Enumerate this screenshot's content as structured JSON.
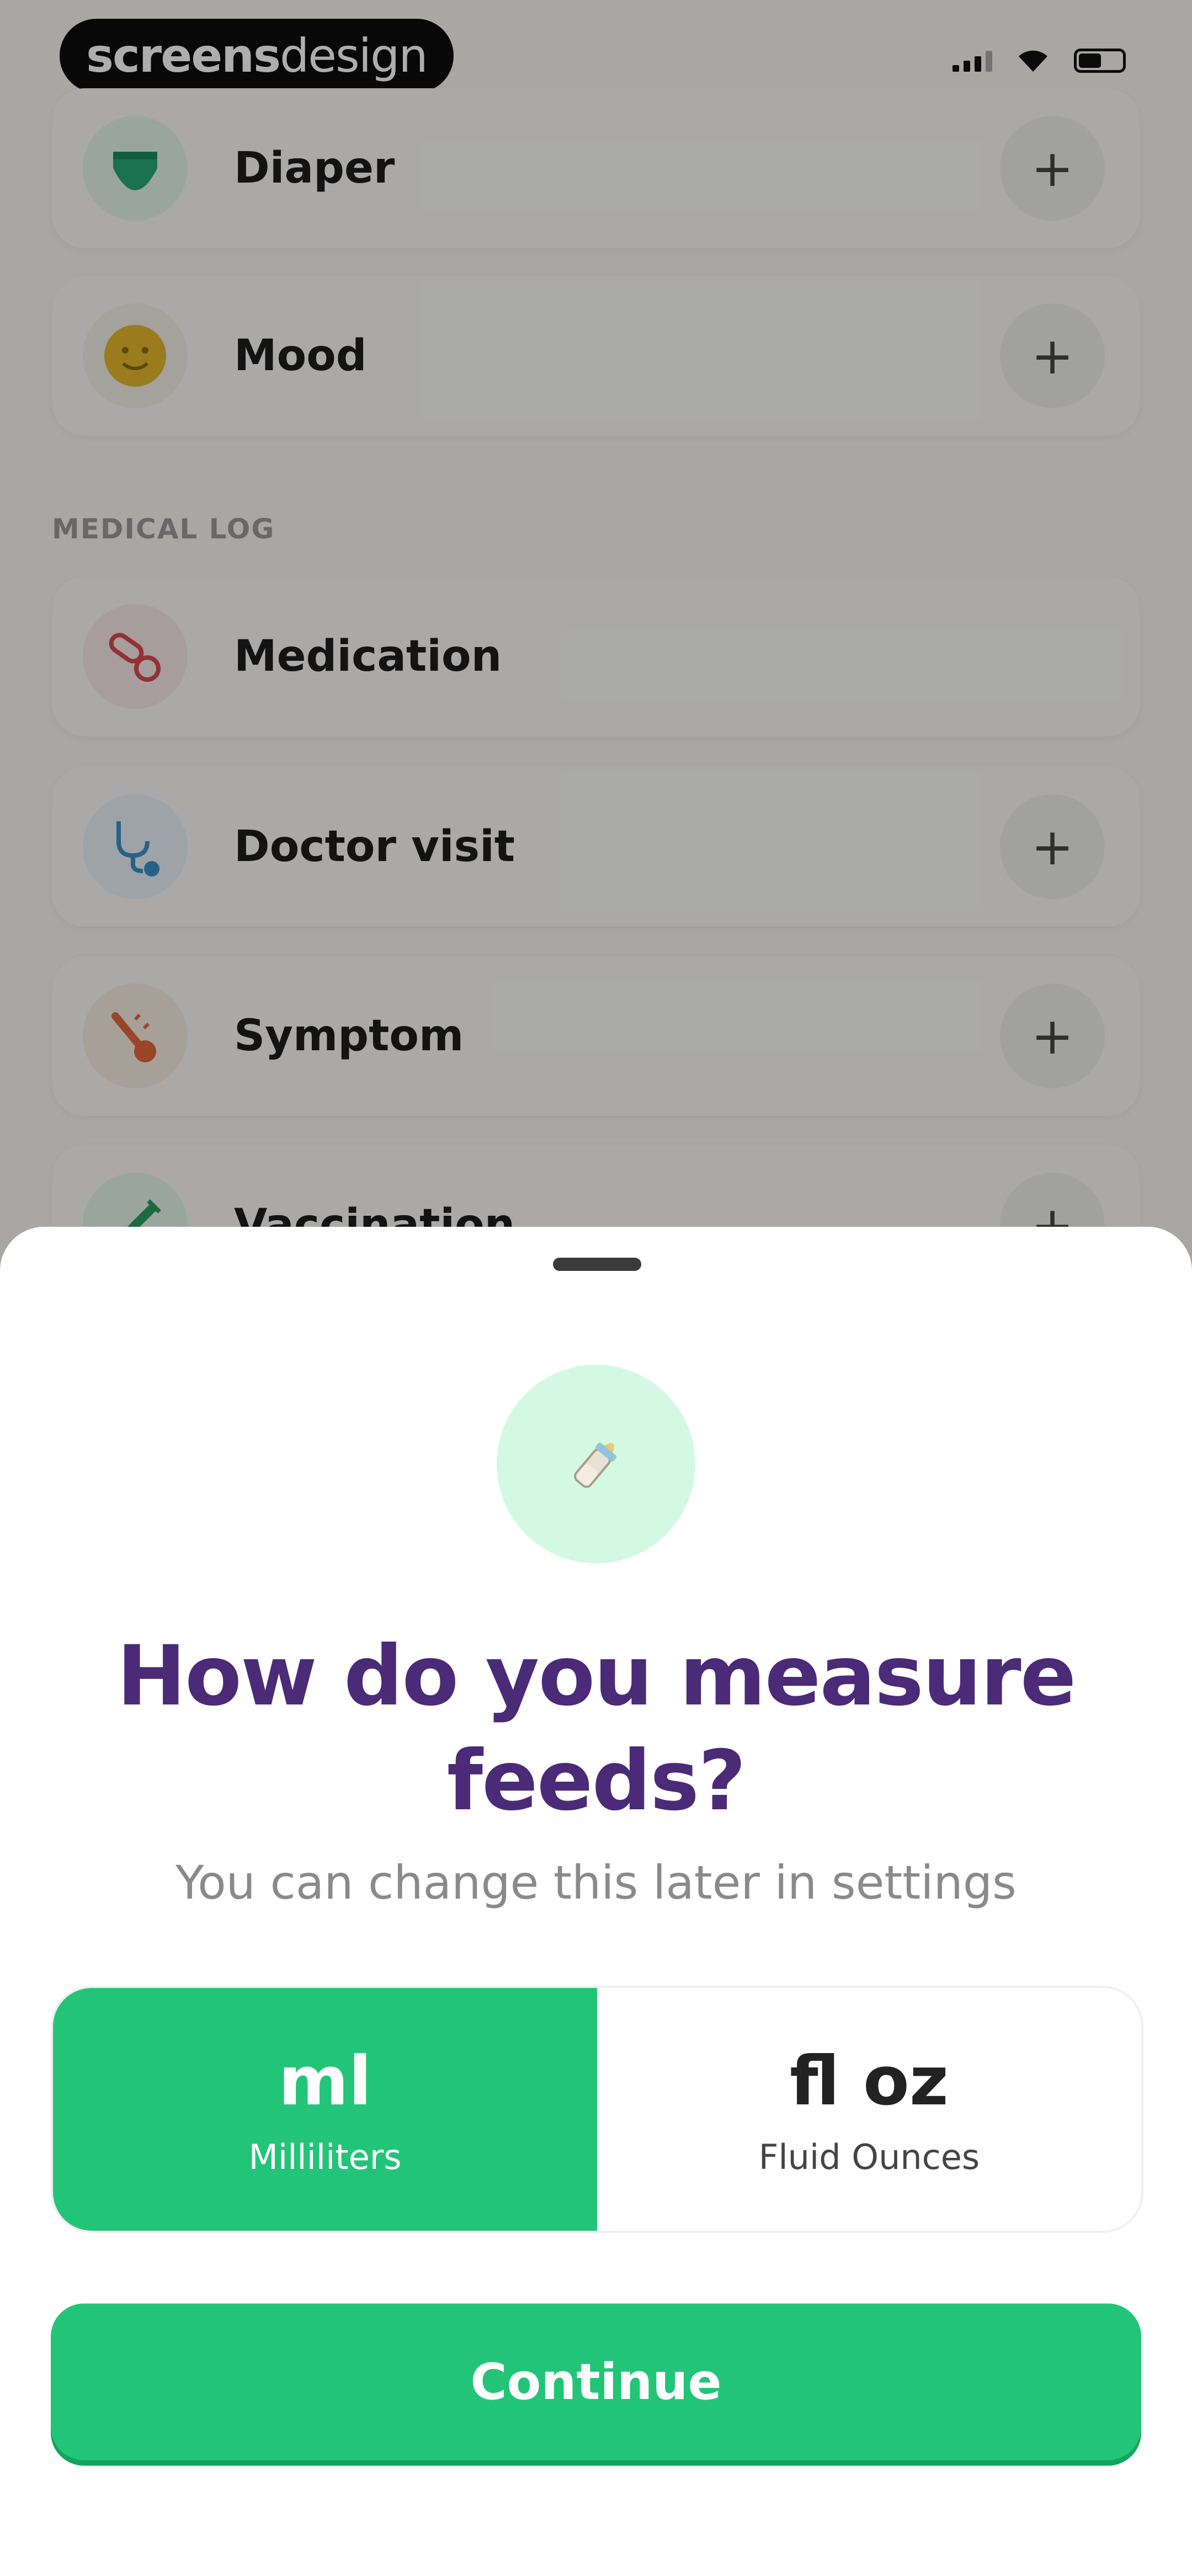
{
  "watermark": {
    "bold": "screens",
    "light": "design"
  },
  "sections": {
    "medical_log_label": "MEDICAL LOG"
  },
  "log_items": [
    {
      "label": "Diaper",
      "icon": "diaper-icon",
      "has_add": true
    },
    {
      "label": "Mood",
      "icon": "mood-icon",
      "has_add": true
    },
    {
      "label": "Medication",
      "icon": "pills-icon",
      "has_add": false
    },
    {
      "label": "Doctor visit",
      "icon": "stethoscope-icon",
      "has_add": true
    },
    {
      "label": "Symptom",
      "icon": "thermometer-icon",
      "has_add": true
    },
    {
      "label": "Vaccination",
      "icon": "syringe-icon",
      "has_add": true
    }
  ],
  "sheet": {
    "icon": "bottle-icon",
    "title": "How do you measure feeds?",
    "subtitle": "You can change this later in settings",
    "options": [
      {
        "unit": "ml",
        "desc": "Milliliters",
        "selected": true
      },
      {
        "unit": "fl oz",
        "desc": "Fluid Ounces",
        "selected": false
      }
    ],
    "continue_label": "Continue"
  },
  "colors": {
    "accent": "#22c578",
    "title": "#4b2a78",
    "icon_bg": "#d3f9e2"
  }
}
